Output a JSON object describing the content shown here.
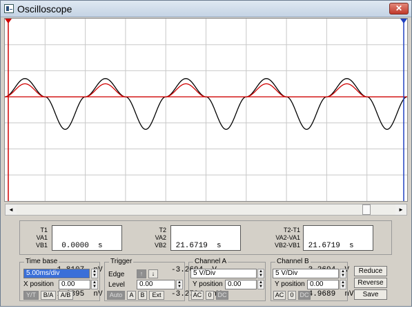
{
  "window": {
    "title": "Oscilloscope",
    "close_label": "✕"
  },
  "chart_data": {
    "type": "line",
    "title": "",
    "xlabel": "",
    "ylabel": "",
    "grid": true,
    "xlim": [
      0,
      10
    ],
    "ylim": [
      -4,
      3
    ],
    "series": [
      {
        "color": "#000000",
        "x": [
          0,
          0.5,
          1,
          1.5,
          2,
          2.5,
          3,
          3.5,
          4,
          4.5,
          5,
          5.5,
          6,
          6.5,
          7,
          7.5,
          8,
          8.5,
          9,
          9.5,
          10
        ],
        "values": [
          0,
          0.7,
          0,
          -1.25,
          0,
          0.7,
          0,
          -1.25,
          0,
          0.7,
          0,
          -1.25,
          0,
          0.7,
          0,
          -1.25,
          0,
          0.7,
          0,
          -1.25,
          0
        ]
      },
      {
        "color": "#d00000",
        "x": [
          0,
          0.5,
          1,
          1.5,
          2,
          2.5,
          3,
          3.5,
          4,
          4.5,
          5,
          5.5,
          6,
          6.5,
          7,
          7.5,
          8,
          8.5,
          9,
          9.5,
          10
        ],
        "values": [
          0,
          0.5,
          0,
          0,
          0,
          0.5,
          0,
          0,
          0,
          0.5,
          0,
          0,
          0,
          0.5,
          0,
          0,
          0,
          0.5,
          0,
          0,
          0
        ]
      },
      {
        "color": "#d00000",
        "x": [
          0,
          10
        ],
        "values": [
          0,
          0
        ]
      }
    ]
  },
  "readout": {
    "col1": {
      "labels": [
        "T1",
        "VA1",
        "VB1"
      ],
      "rows": [
        "  0.0000  s",
        "-1.8107  nV",
        " 1.6895  nV"
      ]
    },
    "col2": {
      "labels": [
        "T2",
        "VA2",
        "VB2"
      ],
      "rows": [
        " 21.6719  s",
        "-3.2694  V",
        "-3.2794  nV"
      ]
    },
    "col3": {
      "labels": [
        "T2-T1",
        "VA2-VA1",
        "VB2-VB1"
      ],
      "rows": [
        " 21.6719  s",
        "-3.2694  V",
        "-4.9689  nV"
      ]
    }
  },
  "timebase": {
    "label": "Time base",
    "value": "5.00ms/div",
    "xpos_label": "X position",
    "xpos": "0.00",
    "buttons": [
      "Y/T",
      "B/A",
      "A/B"
    ]
  },
  "trigger": {
    "label": "Trigger",
    "edge_label": "Edge",
    "level_label": "Level",
    "level": "0.00",
    "buttons": [
      "Auto",
      "A",
      "B",
      "Ext"
    ]
  },
  "channel_a": {
    "label": "Channel A",
    "value": "5 V/Div",
    "ypos_label": "Y position",
    "ypos": "0.00",
    "buttons": [
      "AC",
      "0",
      "DC"
    ]
  },
  "channel_b": {
    "label": "Channel B",
    "value": "5 V/Div",
    "ypos_label": "Y position",
    "ypos": "0.00",
    "buttons": [
      "AC",
      "0",
      "DC"
    ]
  },
  "side_buttons": {
    "reduce": "Reduce",
    "reverse": "Reverse",
    "save": "Save"
  }
}
